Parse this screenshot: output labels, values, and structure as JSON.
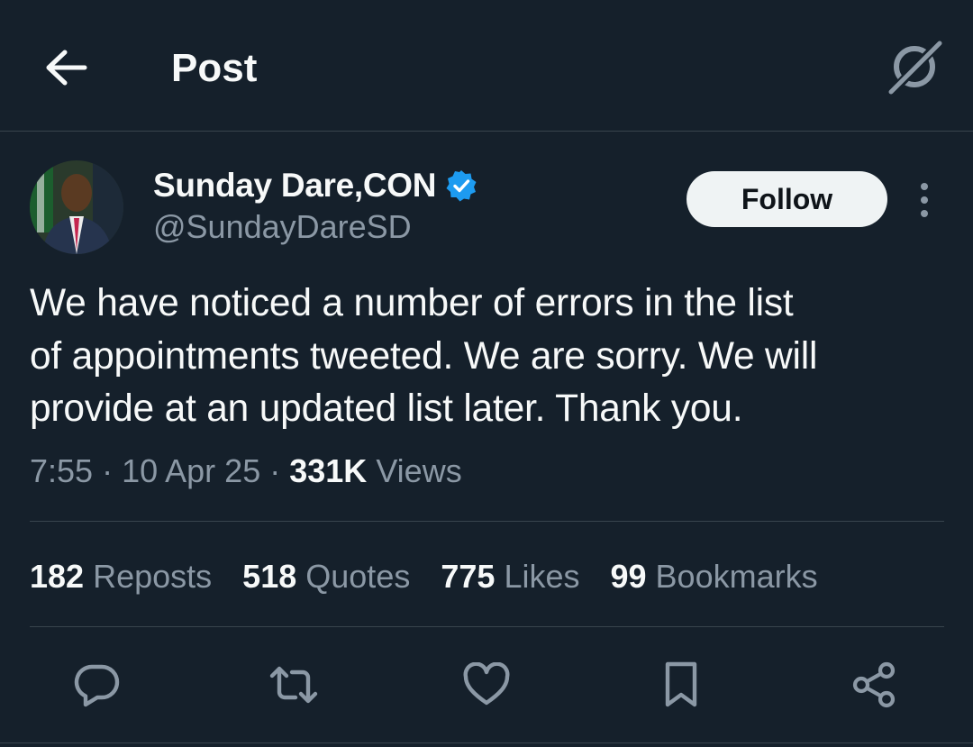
{
  "header": {
    "title": "Post",
    "back_icon": "arrow-left-icon",
    "grok_icon": "grok-icon"
  },
  "author": {
    "name": "Sunday Dare,CON",
    "handle": "@SundayDareSD",
    "verified": true,
    "verified_color": "#1d9bf0",
    "follow_label": "Follow"
  },
  "tweet": {
    "lines": [
      "We have noticed a number of errors in the list",
      "of appointments tweeted. We are sorry. We will",
      "provide at an updated list later. Thank you."
    ]
  },
  "meta": {
    "time": "7:55",
    "date": "10 Apr 25",
    "views_count": "331K",
    "views_label": "Views"
  },
  "stats": [
    {
      "count": "182",
      "label": "Reposts"
    },
    {
      "count": "518",
      "label": "Quotes"
    },
    {
      "count": "775",
      "label": "Likes"
    },
    {
      "count": "99",
      "label": "Bookmarks"
    }
  ],
  "actions": [
    "reply-icon",
    "repost-icon",
    "like-icon",
    "bookmark-icon",
    "share-icon"
  ],
  "colors": {
    "background": "#15202b",
    "text": "#f7f9f9",
    "secondary": "#8b98a5",
    "divider": "#38444d",
    "follow_bg": "#eff3f4"
  }
}
